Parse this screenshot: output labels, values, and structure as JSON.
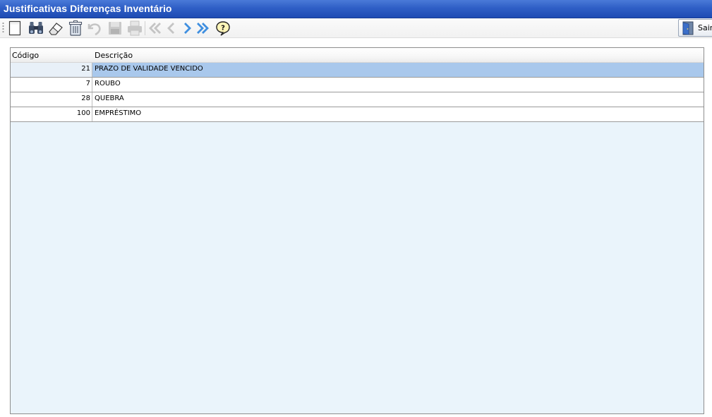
{
  "window": {
    "title": "Justificativas Diferenças Inventário"
  },
  "toolbar": {
    "buttons": [
      {
        "name": "new-icon",
        "enabled": true
      },
      {
        "name": "binoculars-icon",
        "enabled": true
      },
      {
        "name": "eraser-icon",
        "enabled": true
      },
      {
        "name": "trash-icon",
        "enabled": true
      },
      {
        "name": "undo-icon",
        "enabled": false
      },
      {
        "name": "save-icon",
        "enabled": false
      },
      {
        "name": "print-icon",
        "enabled": false
      },
      {
        "name": "first-record-icon",
        "enabled": false
      },
      {
        "name": "previous-record-icon",
        "enabled": false
      },
      {
        "name": "next-record-icon",
        "enabled": true
      },
      {
        "name": "last-record-icon",
        "enabled": true
      },
      {
        "name": "help-icon",
        "enabled": true
      }
    ],
    "exit_label": "Sair"
  },
  "grid": {
    "columns": [
      "Código",
      "Descrição"
    ],
    "rows": [
      {
        "codigo": "21",
        "descricao": "PRAZO DE VALIDADE VENCIDO",
        "selected": true
      },
      {
        "codigo": "7",
        "descricao": "ROUBO",
        "selected": false
      },
      {
        "codigo": "28",
        "descricao": "QUEBRA",
        "selected": false
      },
      {
        "codigo": "100",
        "descricao": "EMPRÉSTIMO",
        "selected": false
      }
    ]
  },
  "colors": {
    "title_bar": "#2f5fc6",
    "selection": "#a9c8ec",
    "grid_background": "#eaf4fb",
    "nav_arrow": "#3f8fe0",
    "disabled_icon": "#c4c4c4"
  }
}
